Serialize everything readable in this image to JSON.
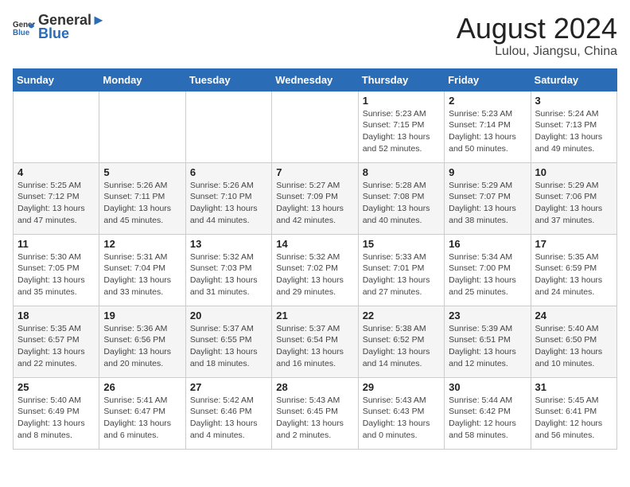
{
  "header": {
    "logo_general": "General",
    "logo_blue": "Blue",
    "month_year": "August 2024",
    "location": "Lulou, Jiangsu, China"
  },
  "weekdays": [
    "Sunday",
    "Monday",
    "Tuesday",
    "Wednesday",
    "Thursday",
    "Friday",
    "Saturday"
  ],
  "weeks": [
    [
      {
        "day": "",
        "content": ""
      },
      {
        "day": "",
        "content": ""
      },
      {
        "day": "",
        "content": ""
      },
      {
        "day": "",
        "content": ""
      },
      {
        "day": "1",
        "content": "Sunrise: 5:23 AM\nSunset: 7:15 PM\nDaylight: 13 hours\nand 52 minutes."
      },
      {
        "day": "2",
        "content": "Sunrise: 5:23 AM\nSunset: 7:14 PM\nDaylight: 13 hours\nand 50 minutes."
      },
      {
        "day": "3",
        "content": "Sunrise: 5:24 AM\nSunset: 7:13 PM\nDaylight: 13 hours\nand 49 minutes."
      }
    ],
    [
      {
        "day": "4",
        "content": "Sunrise: 5:25 AM\nSunset: 7:12 PM\nDaylight: 13 hours\nand 47 minutes."
      },
      {
        "day": "5",
        "content": "Sunrise: 5:26 AM\nSunset: 7:11 PM\nDaylight: 13 hours\nand 45 minutes."
      },
      {
        "day": "6",
        "content": "Sunrise: 5:26 AM\nSunset: 7:10 PM\nDaylight: 13 hours\nand 44 minutes."
      },
      {
        "day": "7",
        "content": "Sunrise: 5:27 AM\nSunset: 7:09 PM\nDaylight: 13 hours\nand 42 minutes."
      },
      {
        "day": "8",
        "content": "Sunrise: 5:28 AM\nSunset: 7:08 PM\nDaylight: 13 hours\nand 40 minutes."
      },
      {
        "day": "9",
        "content": "Sunrise: 5:29 AM\nSunset: 7:07 PM\nDaylight: 13 hours\nand 38 minutes."
      },
      {
        "day": "10",
        "content": "Sunrise: 5:29 AM\nSunset: 7:06 PM\nDaylight: 13 hours\nand 37 minutes."
      }
    ],
    [
      {
        "day": "11",
        "content": "Sunrise: 5:30 AM\nSunset: 7:05 PM\nDaylight: 13 hours\nand 35 minutes."
      },
      {
        "day": "12",
        "content": "Sunrise: 5:31 AM\nSunset: 7:04 PM\nDaylight: 13 hours\nand 33 minutes."
      },
      {
        "day": "13",
        "content": "Sunrise: 5:32 AM\nSunset: 7:03 PM\nDaylight: 13 hours\nand 31 minutes."
      },
      {
        "day": "14",
        "content": "Sunrise: 5:32 AM\nSunset: 7:02 PM\nDaylight: 13 hours\nand 29 minutes."
      },
      {
        "day": "15",
        "content": "Sunrise: 5:33 AM\nSunset: 7:01 PM\nDaylight: 13 hours\nand 27 minutes."
      },
      {
        "day": "16",
        "content": "Sunrise: 5:34 AM\nSunset: 7:00 PM\nDaylight: 13 hours\nand 25 minutes."
      },
      {
        "day": "17",
        "content": "Sunrise: 5:35 AM\nSunset: 6:59 PM\nDaylight: 13 hours\nand 24 minutes."
      }
    ],
    [
      {
        "day": "18",
        "content": "Sunrise: 5:35 AM\nSunset: 6:57 PM\nDaylight: 13 hours\nand 22 minutes."
      },
      {
        "day": "19",
        "content": "Sunrise: 5:36 AM\nSunset: 6:56 PM\nDaylight: 13 hours\nand 20 minutes."
      },
      {
        "day": "20",
        "content": "Sunrise: 5:37 AM\nSunset: 6:55 PM\nDaylight: 13 hours\nand 18 minutes."
      },
      {
        "day": "21",
        "content": "Sunrise: 5:37 AM\nSunset: 6:54 PM\nDaylight: 13 hours\nand 16 minutes."
      },
      {
        "day": "22",
        "content": "Sunrise: 5:38 AM\nSunset: 6:52 PM\nDaylight: 13 hours\nand 14 minutes."
      },
      {
        "day": "23",
        "content": "Sunrise: 5:39 AM\nSunset: 6:51 PM\nDaylight: 13 hours\nand 12 minutes."
      },
      {
        "day": "24",
        "content": "Sunrise: 5:40 AM\nSunset: 6:50 PM\nDaylight: 13 hours\nand 10 minutes."
      }
    ],
    [
      {
        "day": "25",
        "content": "Sunrise: 5:40 AM\nSunset: 6:49 PM\nDaylight: 13 hours\nand 8 minutes."
      },
      {
        "day": "26",
        "content": "Sunrise: 5:41 AM\nSunset: 6:47 PM\nDaylight: 13 hours\nand 6 minutes."
      },
      {
        "day": "27",
        "content": "Sunrise: 5:42 AM\nSunset: 6:46 PM\nDaylight: 13 hours\nand 4 minutes."
      },
      {
        "day": "28",
        "content": "Sunrise: 5:43 AM\nSunset: 6:45 PM\nDaylight: 13 hours\nand 2 minutes."
      },
      {
        "day": "29",
        "content": "Sunrise: 5:43 AM\nSunset: 6:43 PM\nDaylight: 13 hours\nand 0 minutes."
      },
      {
        "day": "30",
        "content": "Sunrise: 5:44 AM\nSunset: 6:42 PM\nDaylight: 12 hours\nand 58 minutes."
      },
      {
        "day": "31",
        "content": "Sunrise: 5:45 AM\nSunset: 6:41 PM\nDaylight: 12 hours\nand 56 minutes."
      }
    ]
  ]
}
